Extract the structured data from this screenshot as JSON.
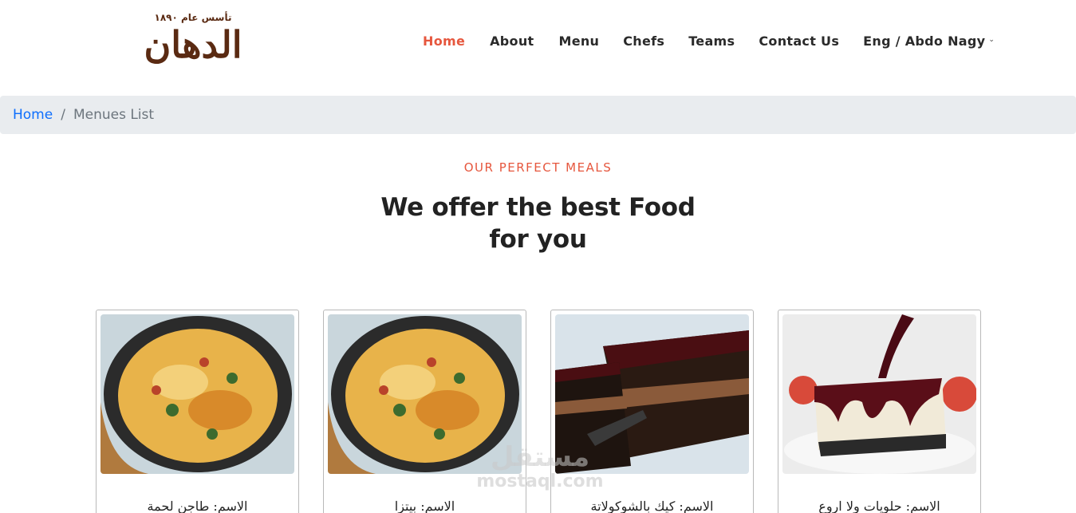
{
  "logo": {
    "name": "الدهان",
    "tagline": "تأسس عام ١٨٩٠"
  },
  "nav": {
    "items": [
      {
        "label": "Home",
        "active": true
      },
      {
        "label": "About"
      },
      {
        "label": "Menu"
      },
      {
        "label": "Chefs"
      },
      {
        "label": "Teams"
      },
      {
        "label": "Contact Us"
      }
    ],
    "user_label": "Eng / Abdo Nagy"
  },
  "breadcrumb": {
    "home": "Home",
    "separator": "/",
    "current": "Menues List"
  },
  "section": {
    "subtitle": "OUR PERFECT MEALS",
    "title_line1": "We offer the best Food",
    "title_line2": "for you"
  },
  "cards": [
    {
      "name": "الاسم: طاجن لحمة",
      "image": "tagine-skillet"
    },
    {
      "name": "الاسم: بيتزا",
      "image": "tagine-skillet"
    },
    {
      "name": "الاسم: كيك بالشوكولاتة",
      "image": "chocolate-cake"
    },
    {
      "name": "الاسم: حلويات ولا اروع",
      "image": "cheesecake"
    }
  ],
  "watermark": {
    "arabic": "مستقل",
    "latin": "mostaql.com"
  },
  "colors": {
    "accent": "#e6573e",
    "link": "#0d6efd",
    "breadcrumb_bg": "#e9ecef",
    "logo": "#5a2a12"
  }
}
